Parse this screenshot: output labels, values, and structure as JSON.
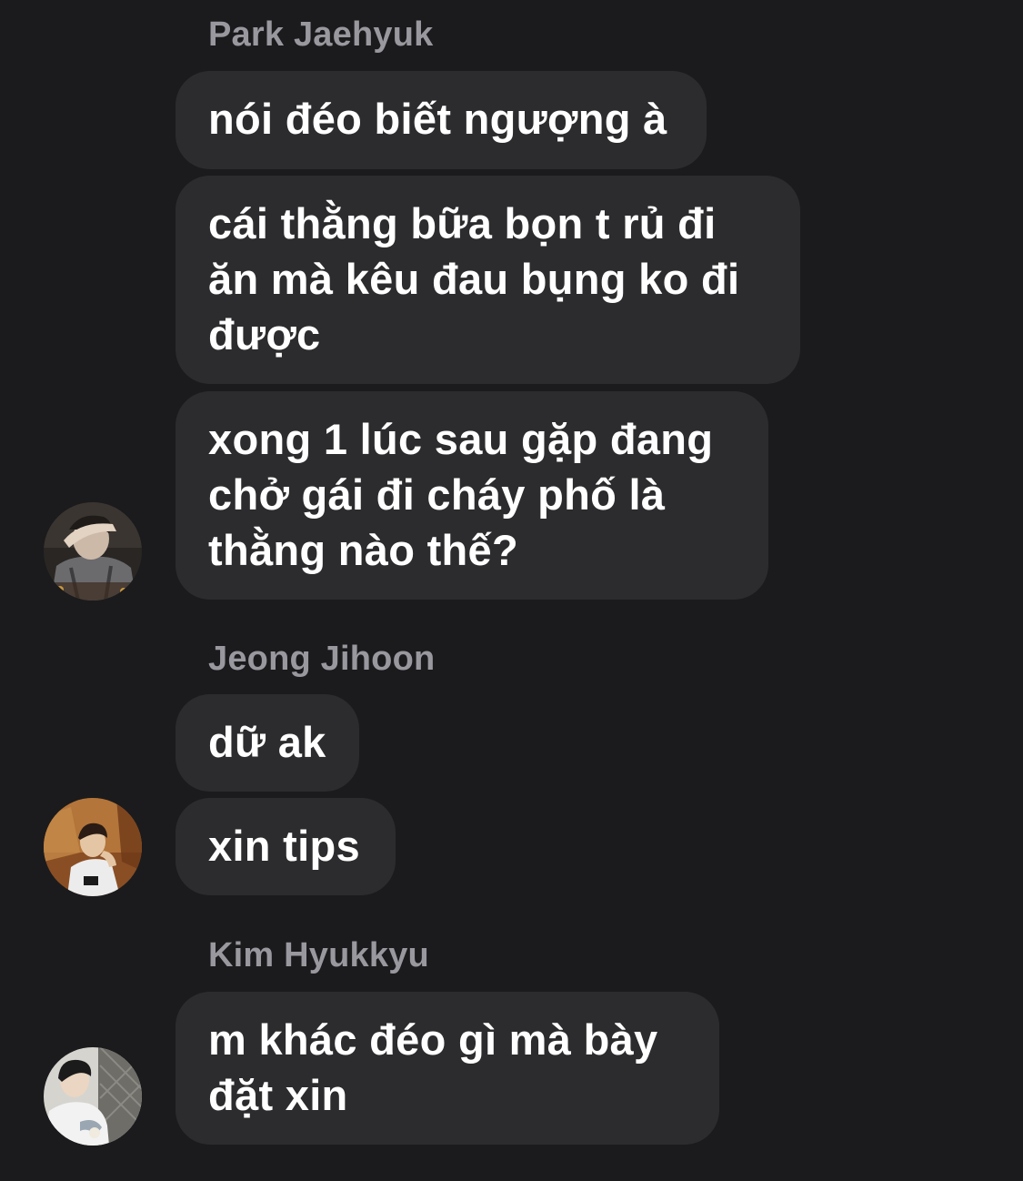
{
  "conversation": [
    {
      "sender": "Park Jaehyuk",
      "avatar_icon": "dark-photo-avatar-icon",
      "messages": [
        {
          "lines": [
            "nói đéo biết ngượng à"
          ]
        },
        {
          "lines": [
            "cái thằng bữa bọn t rủ đi",
            "ăn mà kêu đau bụng ko đi",
            "được"
          ]
        },
        {
          "lines": [
            "xong 1 lúc sau gặp đang",
            "chở gái đi cháy phố là",
            "thằng nào thế?"
          ]
        }
      ]
    },
    {
      "sender": "Jeong Jihoon",
      "avatar_icon": "warm-photo-avatar-icon",
      "messages": [
        {
          "lines": [
            "dữ ak"
          ]
        },
        {
          "lines": [
            "xin tips"
          ]
        }
      ]
    },
    {
      "sender": "Kim Hyukkyu",
      "avatar_icon": "light-photo-avatar-icon",
      "messages": [
        {
          "lines": [
            "m khác đéo gì mà bày",
            "đặt xin"
          ]
        }
      ]
    }
  ],
  "colors": {
    "background": "#1b1b1d",
    "bubble": "#2c2c2e",
    "message_text": "#ffffff",
    "sender_text": "#98989e"
  }
}
